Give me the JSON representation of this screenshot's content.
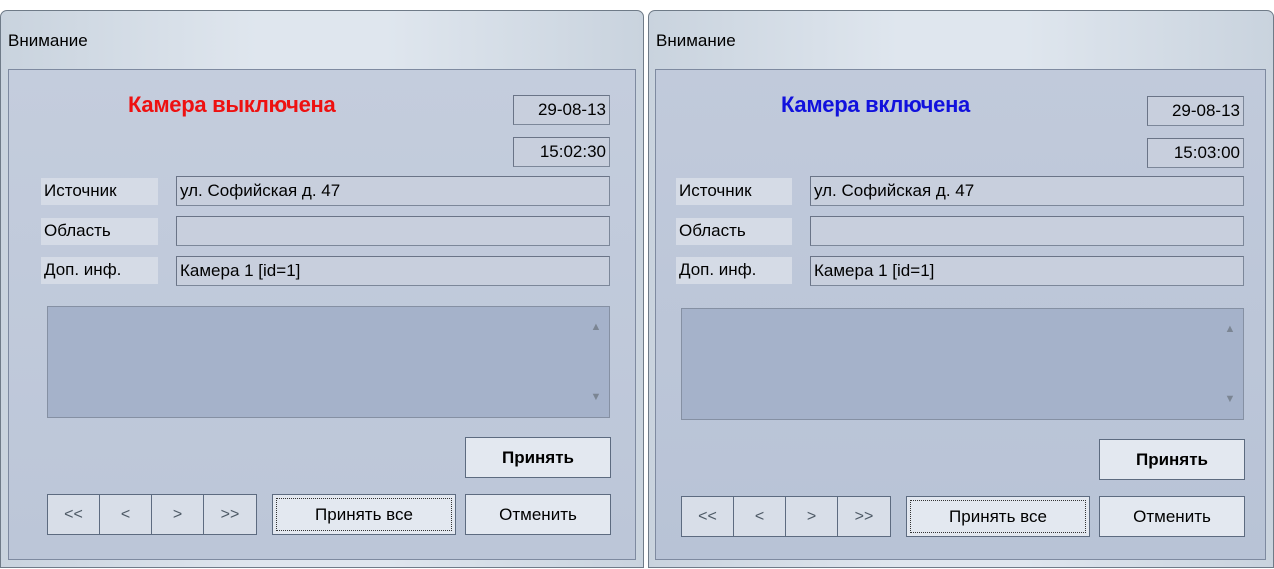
{
  "windows": [
    {
      "title": "Внимание",
      "heading": "Камера выключена",
      "heading_color": "#ee1111",
      "date": "29-08-13",
      "time": "15:02:30",
      "fields": [
        {
          "label": "Источник",
          "value": "ул. Софийская д. 47"
        },
        {
          "label": "Область",
          "value": ""
        },
        {
          "label": "Доп. инф.",
          "value": "Камера 1 [id=1]"
        }
      ],
      "scroll_up": "▲",
      "scroll_down": "▼",
      "accept": "Принять",
      "nav": [
        "<<",
        "<",
        ">",
        ">>"
      ],
      "accept_all": "Принять все",
      "cancel": "Отменить"
    },
    {
      "title": "Внимание",
      "heading": "Камера включена",
      "heading_color": "#1111dd",
      "date": "29-08-13",
      "time": "15:03:00",
      "fields": [
        {
          "label": "Источник",
          "value": "ул. Софийская д. 47"
        },
        {
          "label": "Область",
          "value": ""
        },
        {
          "label": "Доп. инф.",
          "value": "Камера 1 [id=1]"
        }
      ],
      "scroll_up": "▲",
      "scroll_down": "▼",
      "accept": "Принять",
      "nav": [
        "<<",
        "<",
        ">",
        ">>"
      ],
      "accept_all": "Принять все",
      "cancel": "Отменить"
    }
  ]
}
